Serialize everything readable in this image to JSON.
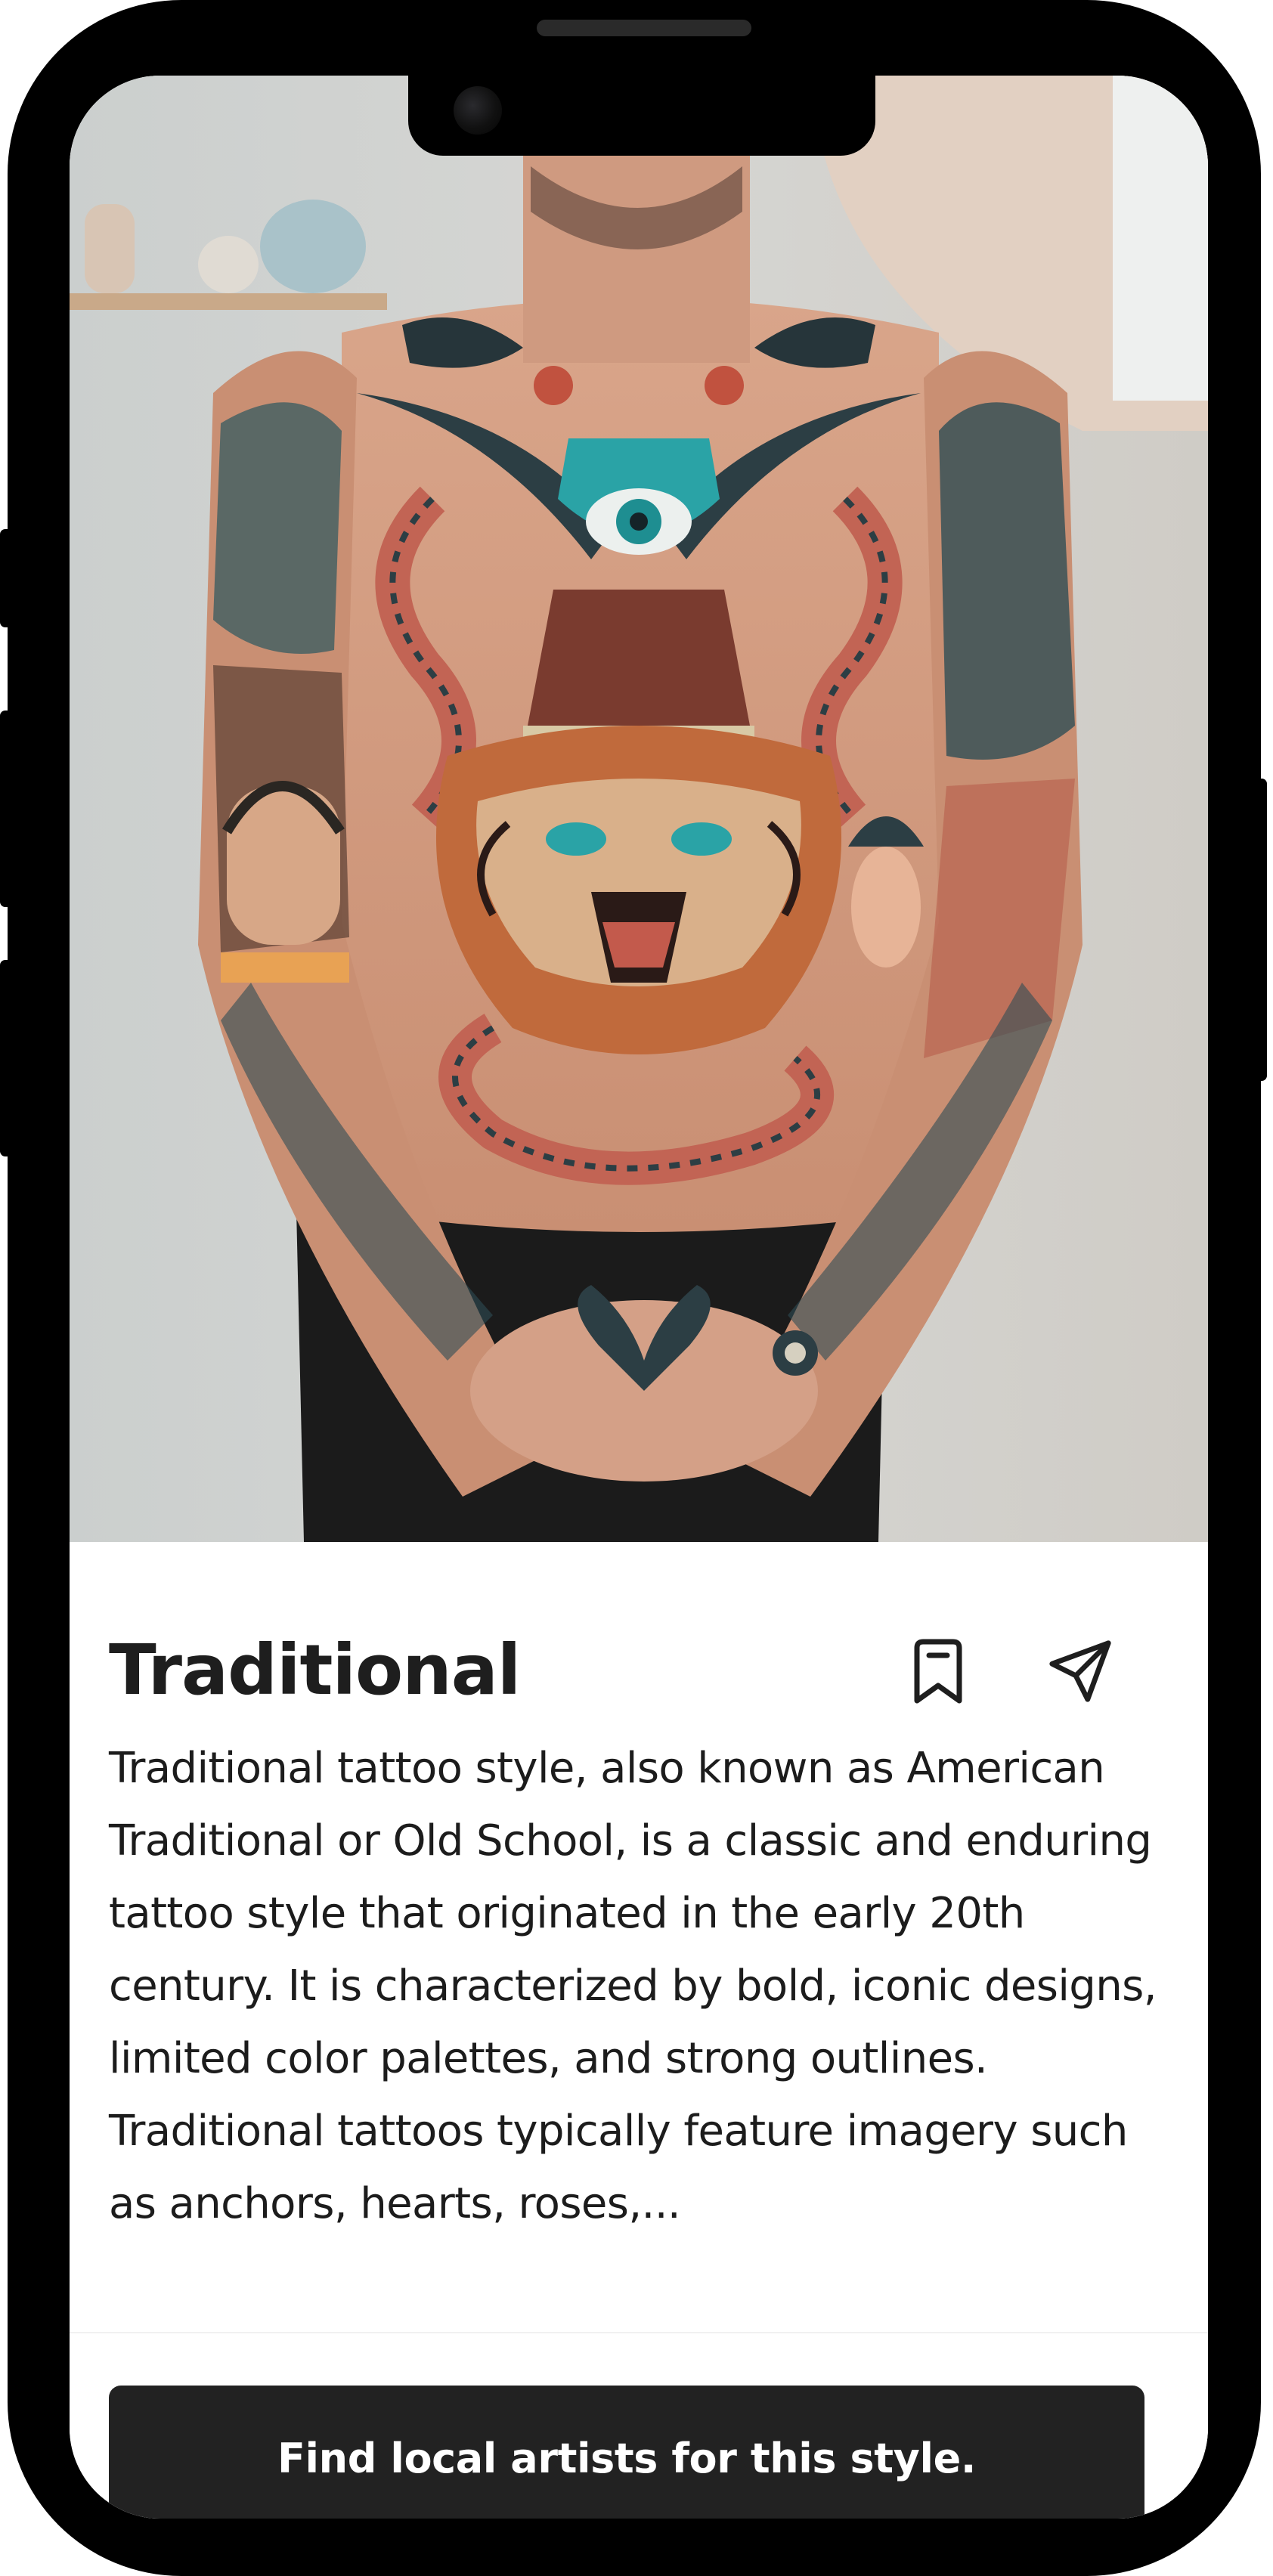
{
  "hero": {
    "icon": "tattoo-photo"
  },
  "style": {
    "title": "Traditional",
    "description": "Traditional tattoo style, also known as American Traditional or Old School, is a classic and enduring tattoo style that originated in the early 20th century. It is characterized by bold, iconic designs, limited color palettes, and strong outlines. Traditional tattoos typically feature imagery such as anchors, hearts, roses,..."
  },
  "actions": {
    "bookmark_icon": "bookmark-icon",
    "share_icon": "send-icon",
    "cta_label": "Find local artists for this style."
  },
  "colors": {
    "cta_background": "#222222",
    "text": "#1e1e1e",
    "frame": "#000000"
  }
}
